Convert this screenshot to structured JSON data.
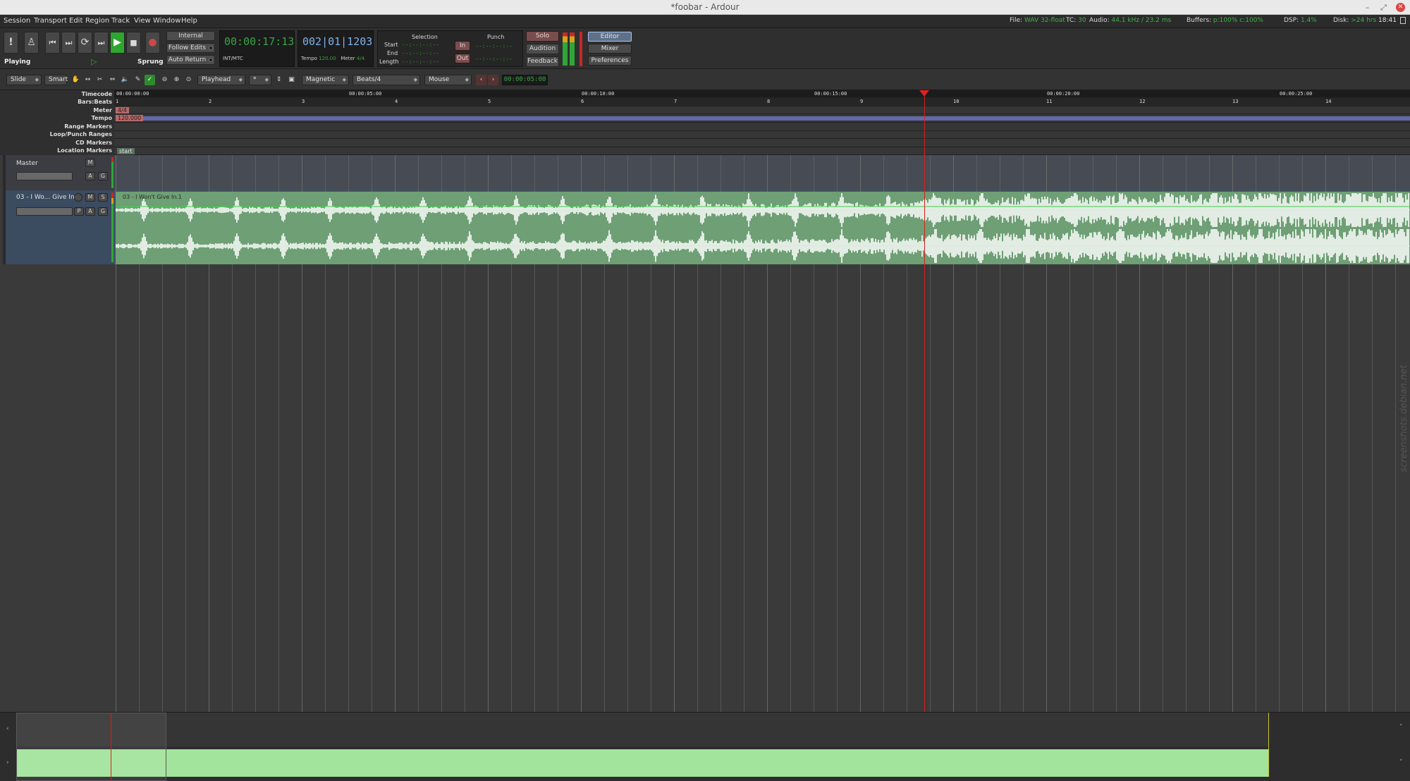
{
  "window": {
    "title": "*foobar - Ardour"
  },
  "menu": [
    "Session",
    "Transport",
    "Edit",
    "Region",
    "Track",
    "View",
    "Window",
    "Help"
  ],
  "status": {
    "file_label": "File:",
    "file_value": "WAV 32-float",
    "tc_label": "TC:",
    "tc_value": "30",
    "audio_label": "Audio:",
    "audio_value": "44.1 kHz / 23.2 ms",
    "buffers_label": "Buffers:",
    "buffers_value": "p:100% c:100%",
    "dsp_label": "DSP:",
    "dsp_value": "1.4%",
    "disk_label": "Disk:",
    "disk_value": ">24 hrs",
    "time": "18:41"
  },
  "transport": {
    "state": "Playing",
    "mode": "Sprung",
    "sync_source": "Internal",
    "follow_edits": "Follow Edits",
    "auto_return": "Auto Return",
    "primary_clock": "00:00:17:13",
    "primary_clock_sub": "INT/MTC",
    "secondary_clock": "002|01|1203",
    "tempo_label": "Tempo",
    "tempo_value": "120.00",
    "meter_label": "Meter",
    "meter_value": "4/4",
    "selection": {
      "title": "Selection",
      "start": "Start",
      "end": "End",
      "length": "Length",
      "empty": "--:--:--:--"
    },
    "punch": {
      "title": "Punch",
      "in": "In",
      "out": "Out",
      "empty": "--:--:--:--"
    },
    "solo": "Solo",
    "audition": "Audition",
    "feedback": "Feedback",
    "tabs": [
      "Editor",
      "Mixer",
      "Preferences"
    ],
    "active_tab": "Editor"
  },
  "toolbar": {
    "edit_mode": "Slide",
    "ripple_mode": "Smart",
    "edit_point": "Playhead",
    "zoom_focus": "*",
    "snap_mode": "Magnetic",
    "grid_type": "Beats/4",
    "edit_point_source": "Mouse",
    "nudge_clock": "00:00:05:00"
  },
  "rulers": {
    "labels": [
      "Timecode",
      "Bars:Beats",
      "Meter",
      "Tempo",
      "Range Markers",
      "Loop/Punch Ranges",
      "CD Markers",
      "Location Markers"
    ],
    "timecode_ticks": [
      "00:00:00:00",
      "00:00:05:00",
      "00:00:10:00",
      "00:00:15:00",
      "00:00:20:00",
      "00:00:25:00"
    ],
    "bar_ticks": [
      "1",
      "2",
      "3",
      "4",
      "5",
      "6",
      "7",
      "8",
      "9",
      "10",
      "11",
      "12",
      "13",
      "14"
    ],
    "meter_marker": "4/4",
    "tempo_marker": "120.000",
    "location_marker": "start"
  },
  "tracks": [
    {
      "name": "Master",
      "buttons": [
        "M",
        "A",
        "G"
      ]
    },
    {
      "name": "03 - I Wo... Give In",
      "buttons": [
        "M",
        "S",
        "P",
        "A",
        "G"
      ]
    }
  ],
  "region": {
    "name": "03 - I Won't Give In.1"
  },
  "playhead_fraction": 0.626,
  "watermark": "screenshots.debian.net",
  "colors": {
    "region": "#6e9f75",
    "playhead": "#d42020",
    "clock_green": "#3aa344",
    "clock_blue": "#7fb2e8",
    "summary_region": "#a2e49b"
  }
}
